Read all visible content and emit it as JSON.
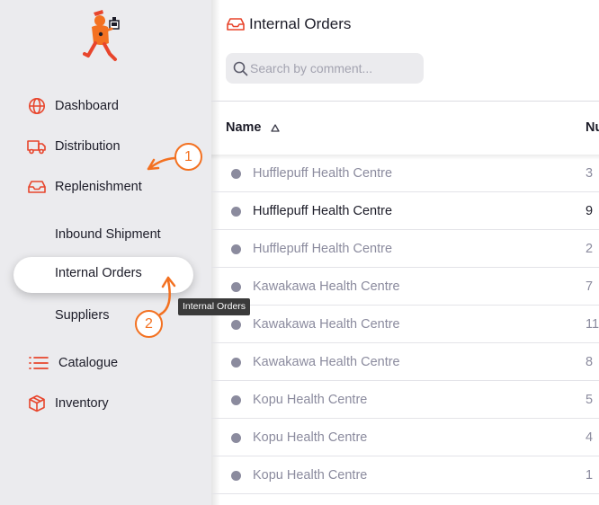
{
  "colors": {
    "accent": "#f37121",
    "sidebar_bg": "#ebebee",
    "text": "#1c1c28",
    "muted": "#8b8b9e"
  },
  "sidebar": {
    "logo": "mascot-logo",
    "items": [
      {
        "label": "Dashboard",
        "icon": "globe-icon"
      },
      {
        "label": "Distribution",
        "icon": "truck-icon"
      },
      {
        "label": "Replenishment",
        "icon": "inbox-icon"
      },
      {
        "label": "Catalogue",
        "icon": "list-icon"
      },
      {
        "label": "Inventory",
        "icon": "box-icon"
      }
    ],
    "sub_items": [
      {
        "label": "Inbound Shipment"
      },
      {
        "label": "Internal Orders",
        "active": true
      },
      {
        "label": "Suppliers"
      }
    ]
  },
  "tooltip": "Internal Orders",
  "annotations": [
    "1",
    "2"
  ],
  "header": {
    "title": "Internal Orders",
    "icon": "inbox-icon",
    "search_placeholder": "Search by comment..."
  },
  "table": {
    "columns": [
      {
        "label": "Name",
        "sort": "ascending"
      },
      {
        "label": "Nu"
      }
    ],
    "rows": [
      {
        "name": "Hufflepuff Health Centre",
        "num": "3",
        "style": "muted"
      },
      {
        "name": "Hufflepuff Health Centre",
        "num": "9",
        "style": "dark"
      },
      {
        "name": "Hufflepuff Health Centre",
        "num": "2",
        "style": "muted"
      },
      {
        "name": "Kawakawa Health Centre",
        "num": "7",
        "style": "muted"
      },
      {
        "name": "Kawakawa Health Centre",
        "num": "11",
        "style": "muted"
      },
      {
        "name": "Kawakawa Health Centre",
        "num": "8",
        "style": "muted"
      },
      {
        "name": "Kopu Health Centre",
        "num": "5",
        "style": "muted"
      },
      {
        "name": "Kopu Health Centre",
        "num": "4",
        "style": "muted"
      },
      {
        "name": "Kopu Health Centre",
        "num": "1",
        "style": "muted"
      }
    ]
  }
}
